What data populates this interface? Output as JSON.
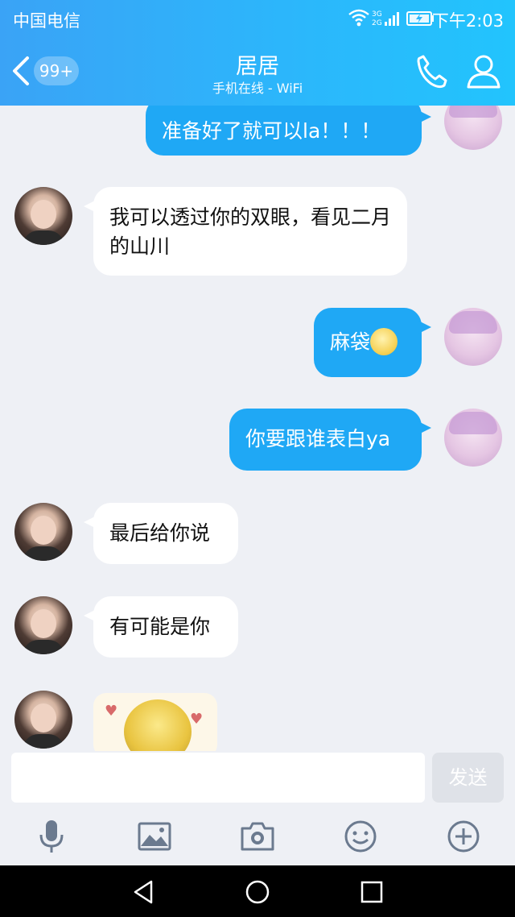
{
  "status_bar": {
    "carrier": "中国电信",
    "time": "下午2:03",
    "network": "3G 2G"
  },
  "header": {
    "title": "居居",
    "subtitle": "手机在线 - WiFi",
    "unread_badge": "99+"
  },
  "messages": [
    {
      "side": "out",
      "text": "准备好了就可以la！！！"
    },
    {
      "side": "in",
      "text": "我可以透过你的双眼，看见二月的山川"
    },
    {
      "side": "out",
      "text": "麻袋",
      "emoji": "moon-face-emoji"
    },
    {
      "side": "out",
      "text": "你要跟谁表白ya"
    },
    {
      "side": "in",
      "text": "最后给你说"
    },
    {
      "side": "in",
      "text": "有可能是你"
    },
    {
      "side": "in",
      "type": "sticker"
    }
  ],
  "input": {
    "placeholder": "",
    "value": ""
  },
  "send_label": "发送",
  "toolbar": [
    "microphone-icon",
    "image-icon",
    "camera-icon",
    "emoji-icon",
    "plus-icon"
  ],
  "colors": {
    "header_start": "#3aa3f6",
    "header_end": "#22c4fd",
    "out_bubble": "#1fa8f5",
    "in_bubble": "#ffffff",
    "chat_bg": "#eef0f5"
  }
}
